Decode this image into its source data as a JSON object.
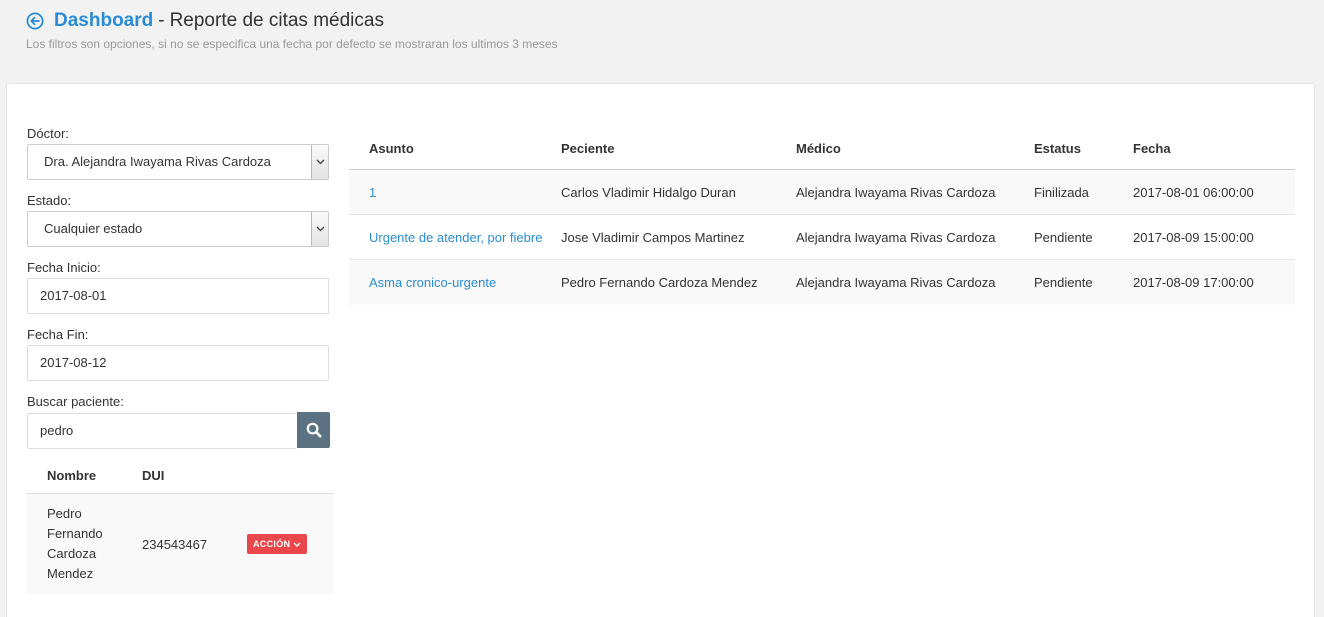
{
  "header": {
    "back_icon": "arrow-left-circle-icon",
    "dashboard_link": "Dashboard",
    "separator": "-",
    "title": "Reporte de citas médicas",
    "subtitle": "Los filtros son opciones, si no se especifica una fecha por defecto se mostraran los ultimos 3 meses"
  },
  "filters": {
    "doctor": {
      "label": "Dóctor:",
      "value": "Dra. Alejandra Iwayama Rivas Cardoza"
    },
    "estado": {
      "label": "Estado:",
      "value": "Cualquier estado"
    },
    "fecha_inicio": {
      "label": "Fecha Inicio:",
      "value": "2017-08-01"
    },
    "fecha_fin": {
      "label": "Fecha Fin:",
      "value": "2017-08-12"
    },
    "buscar": {
      "label": "Buscar paciente:",
      "value": "pedro",
      "icon": "search-icon"
    }
  },
  "patients": {
    "headers": {
      "nombre": "Nombre",
      "dui": "DUI"
    },
    "rows": [
      {
        "name_lines": [
          "Pedro",
          "Fernando",
          "Cardoza",
          "Mendez"
        ],
        "dui": "234543467",
        "action": "ACCIÓN"
      }
    ]
  },
  "appointments": {
    "headers": {
      "asunto": "Asunto",
      "paciente": "Peciente",
      "medico": "Médico",
      "estatus": "Estatus",
      "fecha": "Fecha"
    },
    "rows": [
      {
        "asunto": "1",
        "paciente": "Carlos Vladimir Hidalgo Duran",
        "medico": "Alejandra Iwayama Rivas Cardoza",
        "estatus": "Finilizada",
        "fecha": "2017-08-01 06:00:00"
      },
      {
        "asunto": "Urgente de atender, por fiebre",
        "paciente": "Jose Vladimir Campos Martinez",
        "medico": "Alejandra Iwayama Rivas Cardoza",
        "estatus": "Pendiente",
        "fecha": "2017-08-09 15:00:00"
      },
      {
        "asunto": "Asma cronico-urgente",
        "paciente": "Pedro Fernando Cardoza Mendez",
        "medico": "Alejandra Iwayama Rivas Cardoza",
        "estatus": "Pendiente",
        "fecha": "2017-08-09 17:00:00"
      }
    ]
  },
  "colors": {
    "link": "#2a8cd6",
    "search_button": "#5a7281",
    "action_button": "#e9474c"
  }
}
